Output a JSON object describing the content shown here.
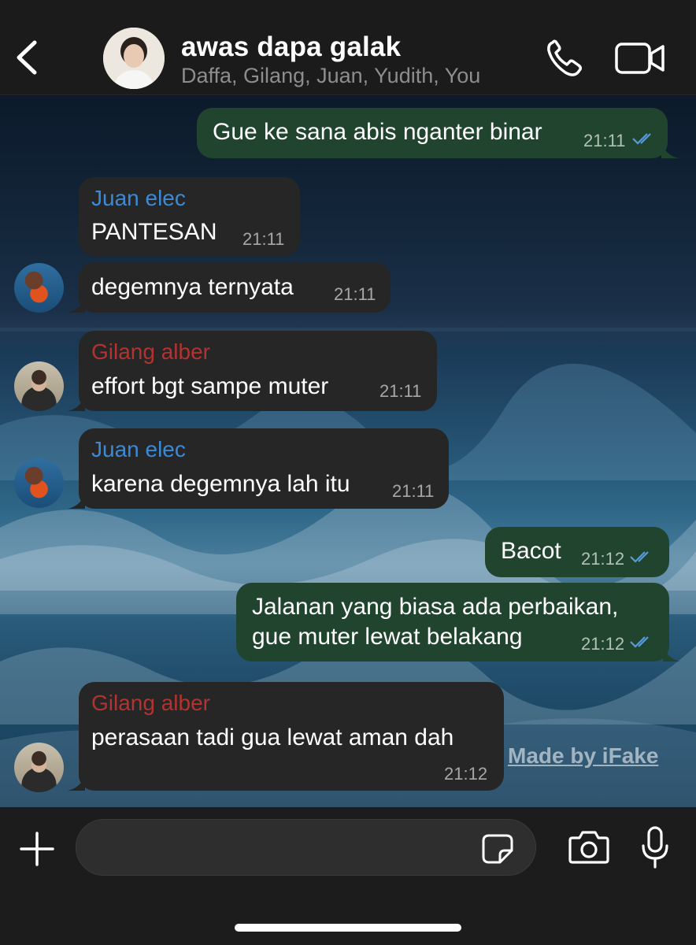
{
  "header": {
    "title": "awas dapa galak",
    "subtitle": "Daffa, Gilang, Juan, Yudith, You"
  },
  "messages": [
    {
      "direction": "out",
      "text": "Gue ke sana abis nganter binar",
      "time": "21:11",
      "status": "read"
    },
    {
      "direction": "in",
      "sender": "Juan elec",
      "sender_color": "#3a8ad8",
      "text": "PANTESAN",
      "time": "21:11"
    },
    {
      "direction": "in",
      "text": "degemnya ternyata",
      "time": "21:11"
    },
    {
      "direction": "in",
      "sender": "Gilang alber",
      "sender_color": "#b2332f",
      "text": "effort bgt sampe muter",
      "time": "21:11"
    },
    {
      "direction": "in",
      "sender": "Juan elec",
      "sender_color": "#3a8ad8",
      "text": "karena degemnya lah itu",
      "time": "21:11"
    },
    {
      "direction": "out",
      "text": "Bacot",
      "time": "21:12",
      "status": "read"
    },
    {
      "direction": "out",
      "text_line1": "Jalanan yang biasa ada perbaikan,",
      "text_line2": "gue muter lewat belakang",
      "time": "21:12",
      "status": "read"
    },
    {
      "direction": "in",
      "sender": "Gilang alber",
      "sender_color": "#b2332f",
      "text": "perasaan tadi gua lewat aman dah",
      "time": "21:12"
    }
  ],
  "watermark": "Made by iFake",
  "composer": {
    "placeholder": ""
  },
  "colors": {
    "outgoing_bubble": "#21442e",
    "incoming_bubble": "#262626",
    "read_ticks": "#5b9bd5"
  },
  "icons": [
    "back-chevron-icon",
    "phone-icon",
    "video-camera-icon",
    "plus-icon",
    "sticker-icon",
    "camera-icon",
    "microphone-icon",
    "double-check-icon"
  ]
}
